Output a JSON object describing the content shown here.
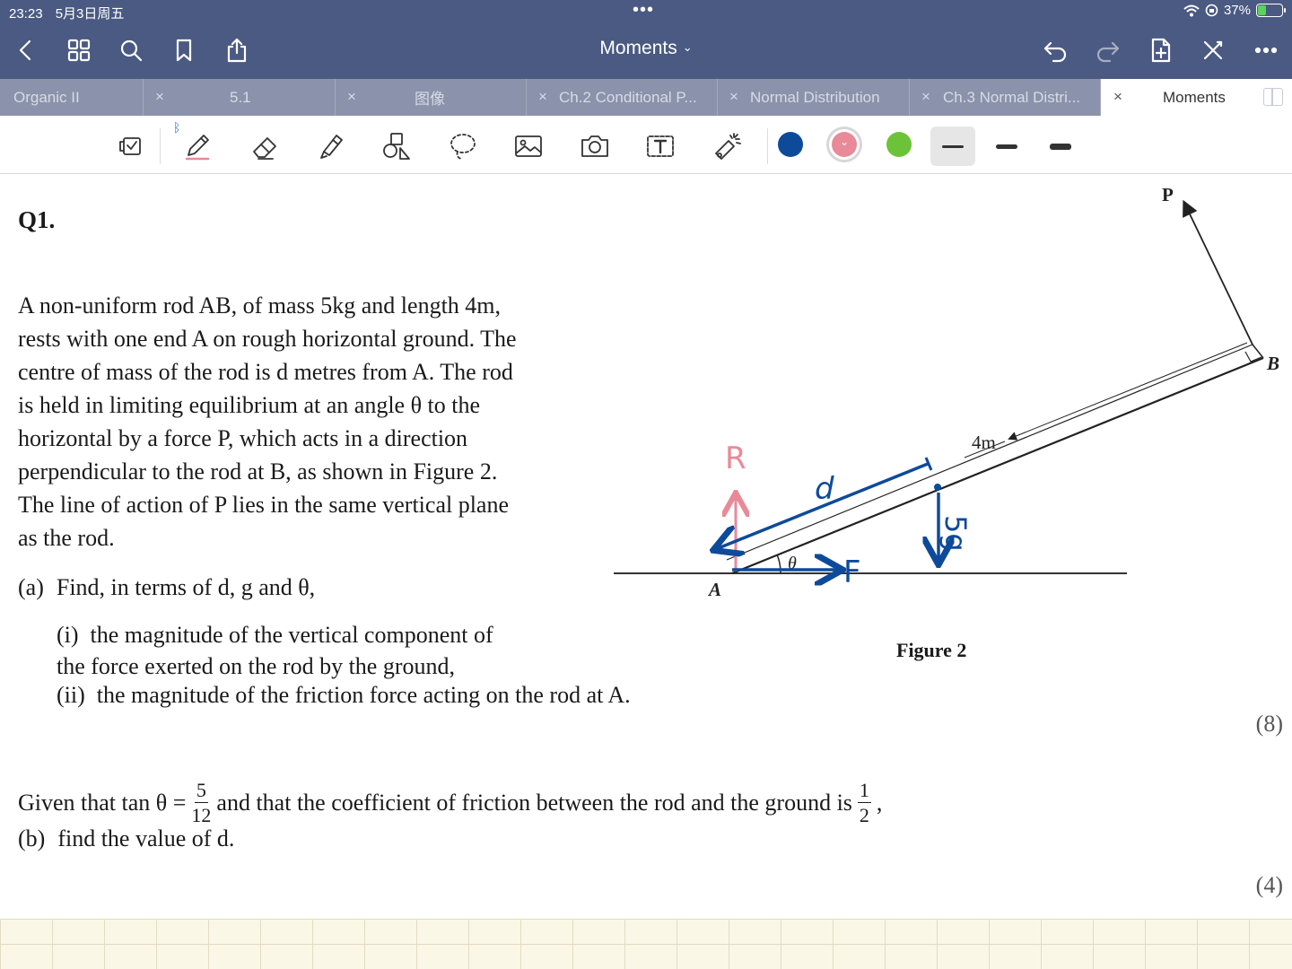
{
  "status": {
    "time": "23:23",
    "date": "5月3日周五",
    "battery": "37%",
    "battery_level": 0.37
  },
  "nav": {
    "title": "Moments",
    "icons": [
      "back-icon",
      "grid-icon",
      "search-icon",
      "bookmark-icon",
      "share-icon",
      "undo-icon",
      "redo-icon",
      "add-page-icon",
      "close-pen-icon",
      "more-icon"
    ]
  },
  "tabs": [
    {
      "label": "Organic II",
      "active": false
    },
    {
      "label": "5.1",
      "active": false
    },
    {
      "label": "图像",
      "active": false
    },
    {
      "label": "Ch.2 Conditional P...",
      "active": false
    },
    {
      "label": "Normal Distribution",
      "active": false
    },
    {
      "label": "Ch.3 Normal Distri...",
      "active": false
    },
    {
      "label": "Moments",
      "active": true
    }
  ],
  "tools": [
    "read-mode-icon",
    "pen-icon",
    "eraser-icon",
    "highlighter-icon",
    "shapes-icon",
    "lasso-icon",
    "image-icon",
    "camera-icon",
    "text-icon",
    "laser-pointer-icon"
  ],
  "colors": {
    "navy": "#0d4a9a",
    "pink": "#e88a98",
    "green": "#6cc33a",
    "selected": "pink"
  },
  "thicknesses": {
    "selected": "thin",
    "options": [
      "thin",
      "medium",
      "thick"
    ]
  },
  "question": {
    "number": "Q1.",
    "lines": [
      "A non-uniform rod AB, of mass 5kg and length 4m,",
      "rests with one end A on rough horizontal ground. The",
      "centre of mass of the rod is d metres from A. The rod",
      "is held in limiting equilibrium at an angle θ to the",
      "horizontal by a force P, which acts in a direction",
      "perpendicular to the rod at B, as shown in Figure 2.",
      "The line of action of P lies in the same vertical plane",
      "as the rod."
    ],
    "part_a": {
      "label": "(a)",
      "text": "Find, in terms of d, g and θ,"
    },
    "sub_i_label": "(i)",
    "sub_i_text_1": "the magnitude of the vertical component of",
    "sub_i_text_2": "the force exerted on the rod by the ground,",
    "sub_ii_label": "(ii)",
    "sub_ii_text": "the magnitude of the friction force acting on the rod at A.",
    "marks_a": "(8)",
    "given_start": "Given that tan θ =",
    "tan_num": "5",
    "tan_den": "12",
    "given_mid": "and that the coefficient of friction between the rod and the ground is",
    "mu_num": "1",
    "mu_den": "2",
    "given_end": ",",
    "part_b": {
      "label": "(b)",
      "text": "find the value of d."
    },
    "marks_b": "(4)"
  },
  "figure": {
    "caption": "Figure 2",
    "labels": {
      "P": "P",
      "B": "B",
      "A": "A",
      "theta": "θ",
      "length": "4m"
    },
    "annotations": {
      "R": "R",
      "F": "F",
      "d": "d",
      "weight": "5g"
    }
  }
}
